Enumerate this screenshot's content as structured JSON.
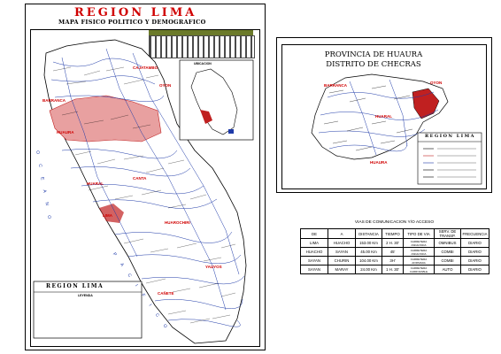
{
  "colors": {
    "title_red": "#d00000",
    "river_blue": "#1e3aa8",
    "land_pink": "#e8a0a0",
    "highlight_red": "#c02020",
    "header_band": "#6b7a2a"
  },
  "left_map": {
    "title": "REGION LIMA",
    "subtitle": "MAPA FISICO POLITICO Y DEMOGRAFICO",
    "ubicacion_label": "UBICACION",
    "ocean_label_1": "O C E A N O",
    "ocean_label_2": "P A C I F I C O",
    "place_labels": [
      "BARRANCA",
      "HUAURA",
      "HUARAL",
      "CANTA",
      "LIMA",
      "HUAROCHIRI",
      "CAÑETE",
      "YAUYOS",
      "OYON",
      "CAJATAMBO"
    ],
    "legend": {
      "title": "REGION LIMA",
      "subtitle": "LEYENDA"
    },
    "icons": [
      "peru-location-map-icon",
      "river-network-icon"
    ]
  },
  "right_map": {
    "province_title": "PROVINCIA DE HUAURA",
    "district_title": "DISTRITO DE CHECRAS",
    "place_labels": [
      "BARRANCA",
      "OYON",
      "HUARAL",
      "HUAURA"
    ],
    "legend": {
      "title": "REGION LIMA"
    }
  },
  "routes_table": {
    "caption": "VIAS DE COMUNICACION Y/O ACCESO",
    "headers": [
      "DE",
      "A",
      "DISTANCIA",
      "TIEMPO",
      "TIPO DE VIA",
      "SERV. DE TRANSP.",
      "FRECUENCIA"
    ],
    "rows": [
      [
        "LIMA",
        "HUACHO",
        "153.00 Km",
        "2 H. 30'",
        "CARRETERA ASFALTADA",
        "OMNIBUS",
        "DIARIO"
      ],
      [
        "HUACHO",
        "SAYAN",
        "45.00 Km",
        "45'",
        "CARRETERA ASFALTADA",
        "COMBI",
        "DIARIO"
      ],
      [
        "SAYAN",
        "CHURIN",
        "104.00 Km",
        "3H'",
        "CARRETERA AFIRMADA",
        "COMBI",
        "DIARIO"
      ],
      [
        "SAYAN",
        "MARAY",
        "24.00 Km",
        "1 H. 30'",
        "CARRETERA CARROZABLE",
        "AUTO",
        "DIARIO"
      ]
    ]
  }
}
